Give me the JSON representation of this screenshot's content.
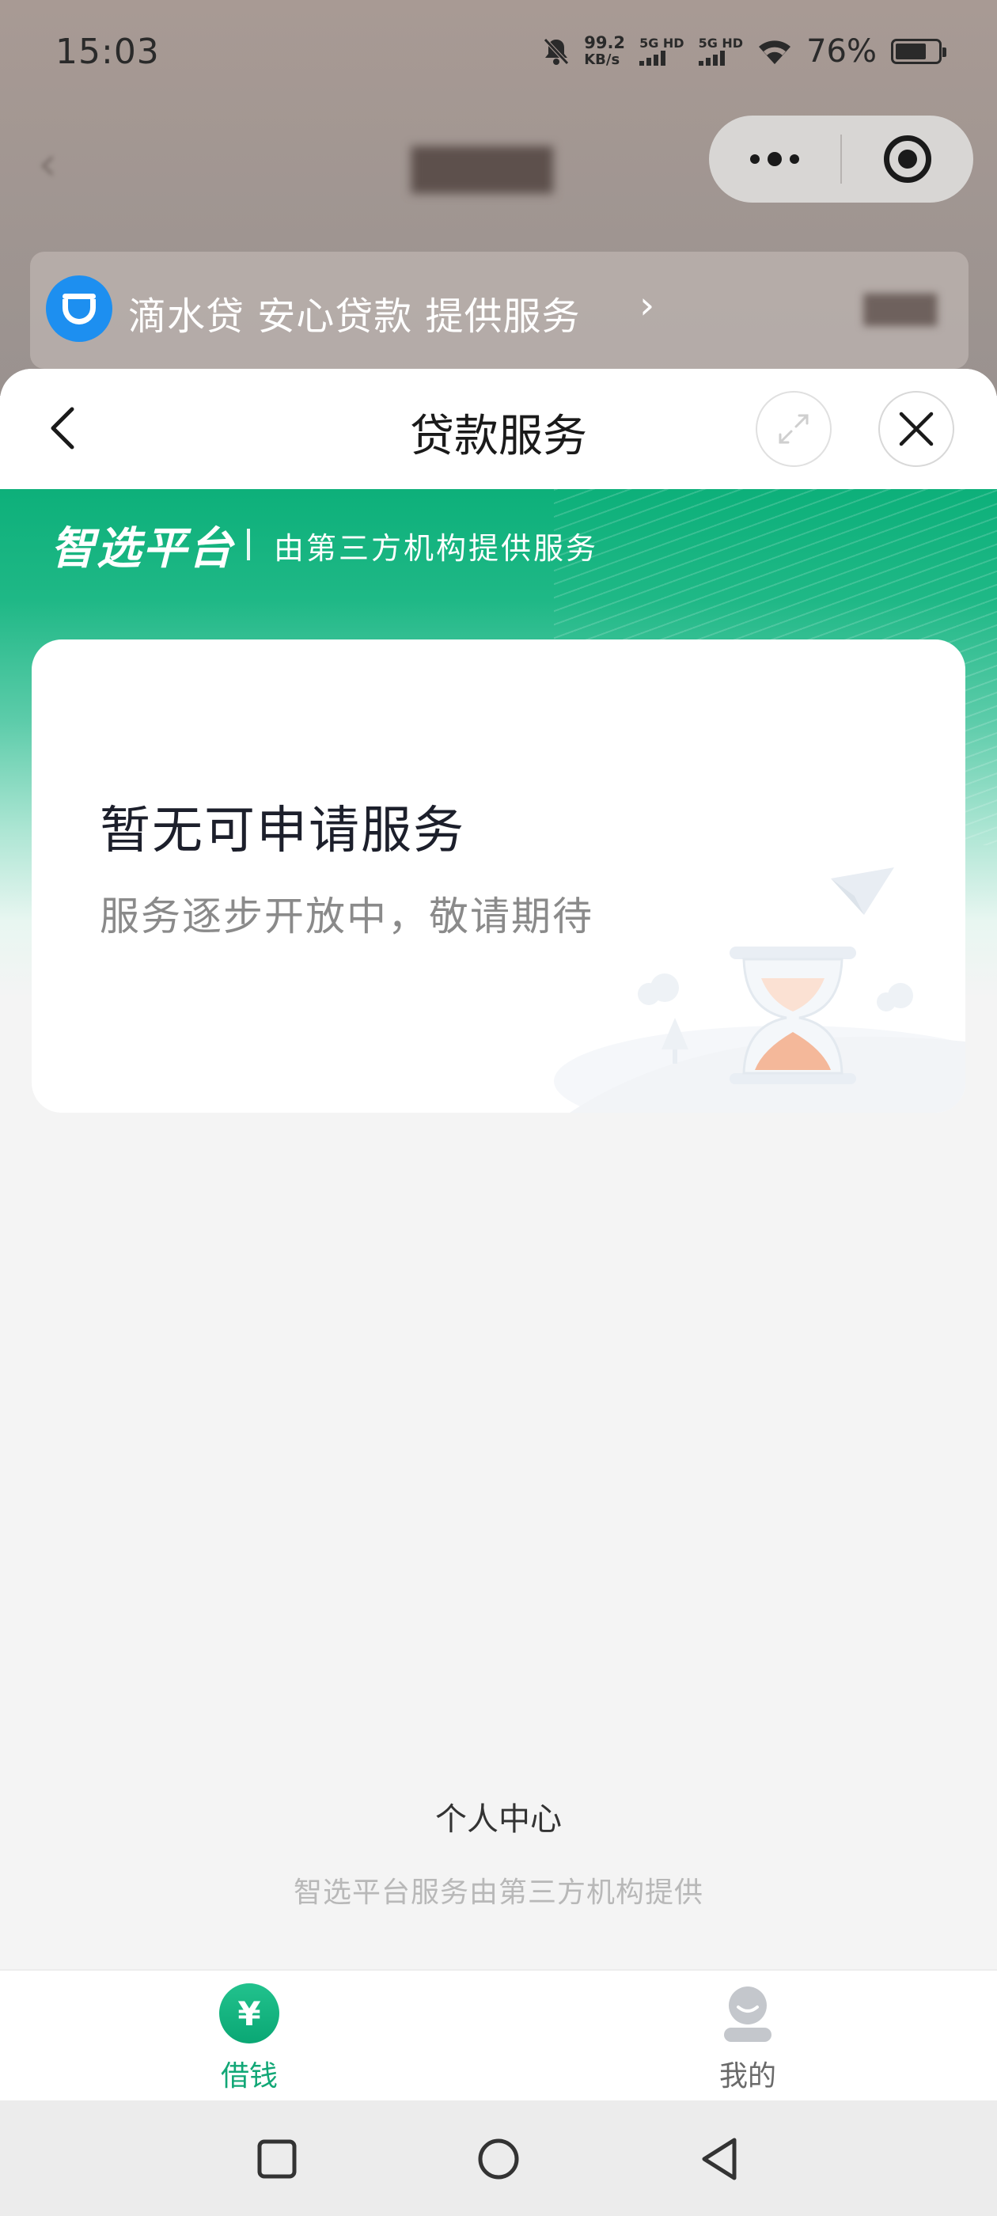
{
  "status_bar": {
    "time": "15:03",
    "net_speed_value": "99.2",
    "net_speed_unit": "KB/s",
    "sim1_label": "5G HD",
    "sim2_label": "5G HD",
    "battery_percent": "76%",
    "battery_level": 0.76,
    "icons": [
      "bell-muted-icon",
      "signal-icon",
      "wifi-icon",
      "battery-icon"
    ]
  },
  "background": {
    "provider_text": "滴水贷 安心贷款 提供服务",
    "provider_chevron": "›"
  },
  "sheet": {
    "title": "贷款服务"
  },
  "banner": {
    "brand": "智选平台",
    "subtitle": "由第三方机构提供服务"
  },
  "card": {
    "title": "暂无可申请服务",
    "subtitle": "服务逐步开放中，敬请期待"
  },
  "footer": {
    "title": "个人中心",
    "subtitle": "智选平台服务由第三方机构提供"
  },
  "tabbar": {
    "tabs": [
      {
        "label": "借钱",
        "icon": "yen-icon",
        "glyph": "¥",
        "active": true
      },
      {
        "label": "我的",
        "icon": "user-icon",
        "active": false
      }
    ]
  },
  "colors": {
    "accent": "#11a776",
    "banner_top": "#0db07a",
    "provider_logo": "#1d8ff0"
  }
}
